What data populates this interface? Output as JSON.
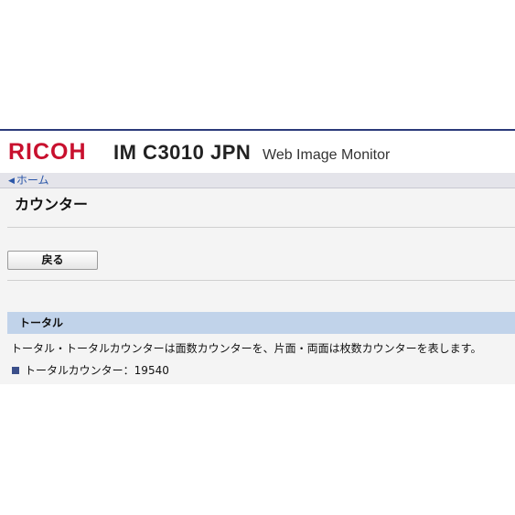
{
  "header": {
    "brand": "RICOH",
    "model": "IM C3010 JPN",
    "product": "Web Image Monitor",
    "brand_color": "#c8102e"
  },
  "breadcrumb": {
    "home_label": "ホーム",
    "home_icon": "left-triangle-icon"
  },
  "page": {
    "title": "カウンター"
  },
  "toolbar": {
    "back_label": "戻る"
  },
  "section": {
    "title": "トータル",
    "header_color": "#c1d3ea",
    "description": "トータル・トータルカウンターは面数カウンターを、片面・両面は枚数カウンターを表します。",
    "counter_label": "トータルカウンター",
    "counter_separator": "：",
    "counter_value": "19540",
    "bullet_icon": "square-bullet-icon"
  }
}
